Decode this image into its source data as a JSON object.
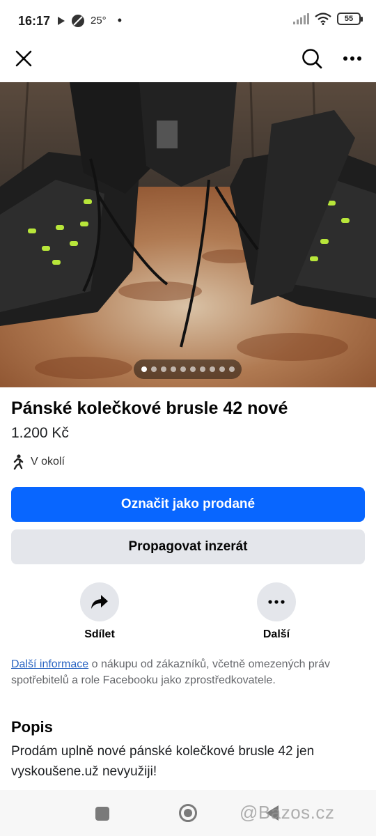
{
  "status_bar": {
    "time": "16:17",
    "temperature": "25°",
    "battery": "55"
  },
  "top_bar": {
    "icons": [
      "close-icon",
      "search-icon",
      "more-horizontal-icon"
    ]
  },
  "photo": {
    "carousel_count": 10,
    "active_index": 0
  },
  "listing": {
    "title": "Pánské kolečkové brusle 42 nové",
    "price": "1.200 Kč",
    "location": "V okolí"
  },
  "buttons": {
    "primary_label": "Označit jako prodané",
    "secondary_label": "Propagovat inzerát"
  },
  "actions": {
    "share_label": "Sdílet",
    "more_label": "Další"
  },
  "info": {
    "link_text": "Další informace",
    "text": " o nákupu od zákazníků, včetně omezených práv spotřebitelů a role Facebooku jako zprostředkovatele."
  },
  "description": {
    "heading": "Popis",
    "text": "Prodám uplně nové pánské kolečkové brusle 42 jen vyskoušene.už nevyužiji!"
  },
  "watermark": "@Bazos.cz",
  "colors": {
    "primary": "#0866ff",
    "secondary_bg": "#e4e6eb",
    "link": "#2b65c2"
  }
}
